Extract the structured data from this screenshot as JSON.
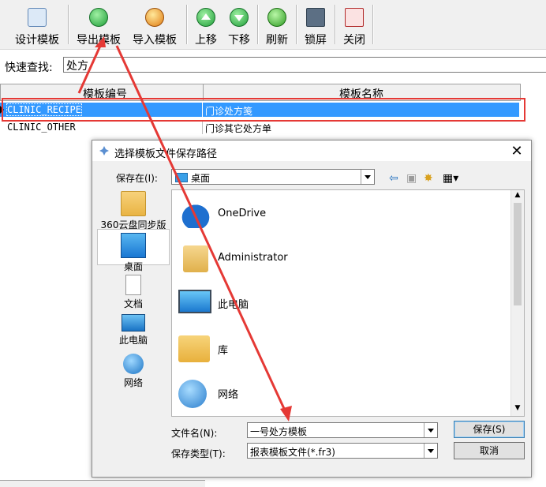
{
  "toolbar": {
    "buttons": [
      {
        "label": "设计模板",
        "icon": "design-template-icon"
      },
      {
        "label": "导出模板",
        "icon": "export-template-icon"
      },
      {
        "label": "导入模板",
        "icon": "import-template-icon"
      },
      {
        "label": "上移",
        "icon": "move-up-icon"
      },
      {
        "label": "下移",
        "icon": "move-down-icon"
      },
      {
        "label": "刷新",
        "icon": "refresh-icon"
      },
      {
        "label": "锁屏",
        "icon": "lock-screen-icon"
      },
      {
        "label": "关闭",
        "icon": "close-window-icon"
      }
    ]
  },
  "search": {
    "label": "快速查找:",
    "value": "处方"
  },
  "grid": {
    "columns": [
      "模板编号",
      "模板名称"
    ],
    "rows": [
      {
        "code": "CLINIC_RECIPE",
        "name": "门诊处方笺"
      },
      {
        "code": "CLINIC_OTHER",
        "name": "门诊其它处方单"
      }
    ]
  },
  "dialog": {
    "title": "选择模板文件保存路径",
    "save_in_label": "保存在(I):",
    "save_in_value": "桌面",
    "places": [
      {
        "label": "360云盘同步版"
      },
      {
        "label": "桌面"
      },
      {
        "label": "文档"
      },
      {
        "label": "此电脑"
      },
      {
        "label": "网络"
      }
    ],
    "files": [
      {
        "name": "OneDrive"
      },
      {
        "name": "Administrator"
      },
      {
        "name": "此电脑"
      },
      {
        "name": "库"
      },
      {
        "name": "网络"
      }
    ],
    "filename_label": "文件名(N):",
    "filename_value": "一号处方模板",
    "filetype_label": "保存类型(T):",
    "filetype_value": "报表模板文件(*.fr3)",
    "save_button": "保存(S)",
    "cancel_button": "取消"
  },
  "colors": {
    "selection": "#3399ff",
    "annotation": "#e53935"
  }
}
